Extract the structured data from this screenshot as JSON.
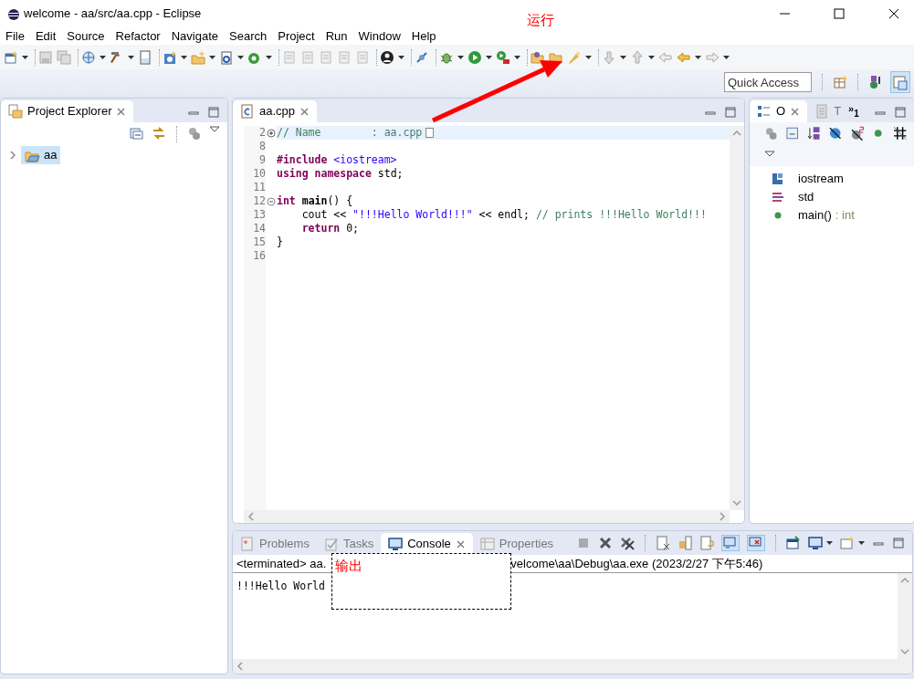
{
  "window": {
    "title": "welcome - aa/src/aa.cpp - Eclipse"
  },
  "run_annotation": {
    "text": "运行"
  },
  "menu": [
    "File",
    "Edit",
    "Source",
    "Refactor",
    "Navigate",
    "Search",
    "Project",
    "Run",
    "Window",
    "Help"
  ],
  "quick_access": {
    "placeholder": "Quick Access"
  },
  "project_explorer": {
    "title": "Project Explorer",
    "items": [
      {
        "label": "aa",
        "expanded": false,
        "selected": true
      }
    ]
  },
  "editor": {
    "tabs": [
      {
        "label": "aa.cpp",
        "selected": true
      }
    ],
    "lines": [
      {
        "number": "2",
        "folded": true,
        "current": true,
        "tokens": [
          {
            "kind": "comment",
            "text": "// Name        : aa.cpp"
          }
        ]
      },
      {
        "number": "8"
      },
      {
        "number": "9",
        "tokens": [
          {
            "kind": "keyword",
            "text": "#include "
          },
          {
            "kind": "string",
            "text": "<iostream>"
          }
        ]
      },
      {
        "number": "10",
        "tokens": [
          {
            "kind": "keyword",
            "text": "using namespace"
          },
          {
            "kind": "plain",
            "text": " std;"
          }
        ]
      },
      {
        "number": "11"
      },
      {
        "number": "12",
        "folded": false,
        "tokens": [
          {
            "kind": "keyword",
            "text": "int "
          },
          {
            "kind": "bold",
            "text": "main"
          },
          {
            "kind": "plain",
            "text": "() {"
          }
        ]
      },
      {
        "number": "13",
        "tokens": [
          {
            "kind": "plain",
            "text": "    cout << "
          },
          {
            "kind": "string",
            "text": "\"!!!Hello World!!!\""
          },
          {
            "kind": "plain",
            "text": " << endl; "
          },
          {
            "kind": "comment",
            "text": "// prints !!!Hello World!!!"
          }
        ]
      },
      {
        "number": "14",
        "tokens": [
          {
            "kind": "keyword",
            "text": "    return"
          },
          {
            "kind": "plain",
            "text": " 0;"
          }
        ]
      },
      {
        "number": "15",
        "tokens": [
          {
            "kind": "plain",
            "text": "}"
          }
        ]
      },
      {
        "number": "16"
      }
    ]
  },
  "outline": {
    "tabs": [
      {
        "label": "O",
        "kind": "outline",
        "selected": true
      },
      {
        "label": "T",
        "kind": "task",
        "selected": false
      }
    ],
    "overflow": {
      "chevron": "»",
      "count": "1"
    },
    "items": [
      {
        "kind": "include",
        "name": "iostream"
      },
      {
        "kind": "namespace",
        "name": "std"
      },
      {
        "kind": "function",
        "name": "main()",
        "type": ": int"
      }
    ]
  },
  "console": {
    "tabs": [
      {
        "label": "Problems",
        "kind": "problems",
        "selected": false
      },
      {
        "label": "Tasks",
        "kind": "tasks",
        "selected": false
      },
      {
        "label": "Console",
        "kind": "console",
        "selected": true
      },
      {
        "label": "Properties",
        "kind": "properties",
        "selected": false
      }
    ],
    "header_start": "<terminated> aa.",
    "header_end": "velcome\\aa\\Debug\\aa.exe (2023/2/27 下午5:46)",
    "output": "!!!Hello World"
  },
  "output_annotation": {
    "text": "输出"
  }
}
